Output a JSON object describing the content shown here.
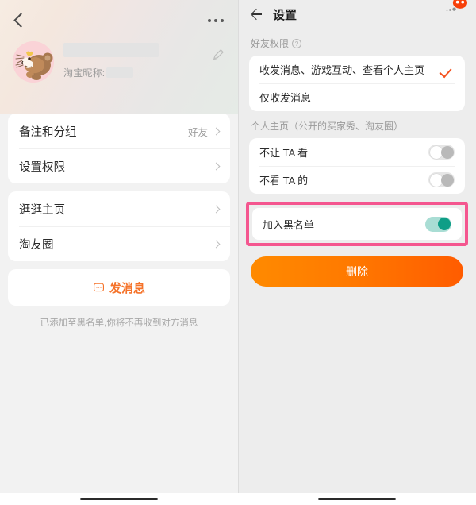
{
  "left": {
    "back_icon": "back-chevron-icon",
    "more_icon": "more-dots-icon",
    "avatar_icon": "jerry-mouse-avatar",
    "edit_icon": "pencil-edit-icon",
    "nickname_label": "淘宝昵称:",
    "list_group_1": [
      {
        "label": "备注和分组",
        "value": "好友"
      },
      {
        "label": "设置权限",
        "value": ""
      }
    ],
    "list_group_2": [
      {
        "label": "逛逛主页",
        "value": ""
      },
      {
        "label": "淘友圈",
        "value": ""
      }
    ],
    "message_button": "发消息",
    "message_icon": "chat-bubble-icon",
    "blacklist_note": "已添加至黑名单,你将不再收到对方消息"
  },
  "right": {
    "back_icon": "back-arrow-icon",
    "title": "设置",
    "chat_icon": "taobao-chat-icon",
    "friend_permission": {
      "section_label": "好友权限",
      "help_icon": "question-mark-icon",
      "options": [
        {
          "label": "收发消息、游戏互动、查看个人主页",
          "selected": true
        },
        {
          "label": "仅收发消息",
          "selected": false
        }
      ],
      "check_icon": "checkmark-icon"
    },
    "personal_page": {
      "section_label": "个人主页（公开的买家秀、淘友圈）",
      "toggles": [
        {
          "label": "不让 TA 看",
          "state": "off"
        },
        {
          "label": "不看 TA 的",
          "state": "off"
        }
      ]
    },
    "blacklist": {
      "label": "加入黑名单",
      "state": "on",
      "highlight_color": "#f4568f"
    },
    "delete_button": "删除"
  },
  "colors": {
    "accent_orange": "#f5732a",
    "toggle_on": "#0f9e87",
    "highlight_pink": "#f4568f",
    "check_orange": "#f4511e"
  }
}
